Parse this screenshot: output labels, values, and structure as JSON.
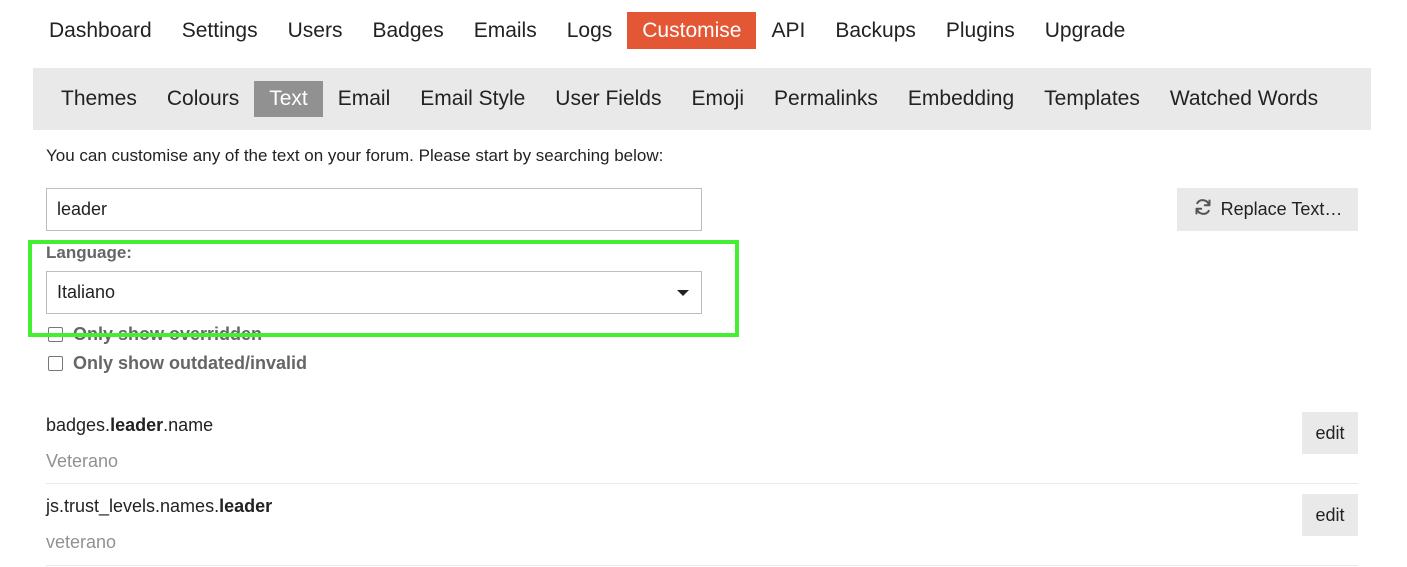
{
  "top_nav": {
    "items": [
      {
        "label": "Dashboard"
      },
      {
        "label": "Settings"
      },
      {
        "label": "Users"
      },
      {
        "label": "Badges"
      },
      {
        "label": "Emails"
      },
      {
        "label": "Logs"
      },
      {
        "label": "Customise"
      },
      {
        "label": "API"
      },
      {
        "label": "Backups"
      },
      {
        "label": "Plugins"
      },
      {
        "label": "Upgrade"
      }
    ],
    "active": "Customise",
    "active_color": "#e45735"
  },
  "sub_nav": {
    "items": [
      {
        "label": "Themes"
      },
      {
        "label": "Colours"
      },
      {
        "label": "Text"
      },
      {
        "label": "Email"
      },
      {
        "label": "Email Style"
      },
      {
        "label": "User Fields"
      },
      {
        "label": "Emoji"
      },
      {
        "label": "Permalinks"
      },
      {
        "label": "Embedding"
      },
      {
        "label": "Templates"
      },
      {
        "label": "Watched Words"
      }
    ],
    "active": "Text"
  },
  "intro_text": "You can customise any of the text on your forum. Please start by searching below:",
  "search": {
    "value": "leader"
  },
  "replace_button": {
    "label": "Replace Text…",
    "icon": "sync-icon"
  },
  "language": {
    "label": "Language:",
    "selected": "Italiano"
  },
  "filters": {
    "only_overridden": "Only show overridden",
    "only_outdated": "Only show outdated/invalid"
  },
  "results": [
    {
      "key_prefix": "badges.",
      "key_match": "leader",
      "key_suffix": ".name",
      "value": "Veterano",
      "edit_label": "edit"
    },
    {
      "key_prefix": "js.trust_levels.names.",
      "key_match": "leader",
      "key_suffix": "",
      "value": "veterano",
      "edit_label": "edit"
    }
  ],
  "highlight_color": "#44ee33"
}
